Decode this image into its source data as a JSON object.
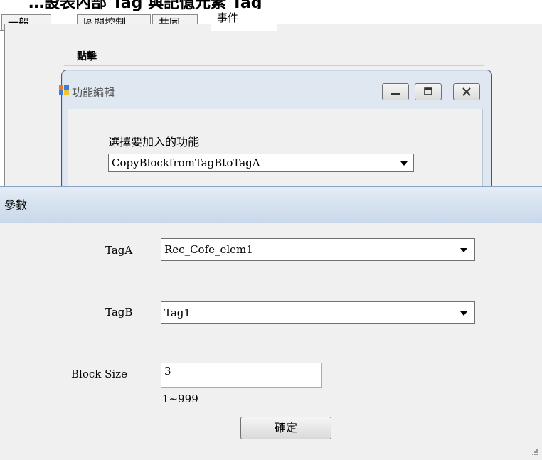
{
  "top_text": "…設表內部 Tag 與記憶元素 Tag",
  "tabs": [
    "一般",
    "區間控制",
    "共同",
    "事件"
  ],
  "active_tab": "事件",
  "section_label": "點擊",
  "function_dialog": {
    "title": "功能編輯",
    "icon": "app-window-icon",
    "choose_label": "選擇要加入的功能",
    "selected_function": "CopyBlockfromTagBtoTagA"
  },
  "params_dialog": {
    "title": "參數",
    "taga_label": "TagA",
    "taga_value": "Rec_Cofe_elem1",
    "tagb_label": "TagB",
    "tagb_value": "Tag1",
    "block_size_label": "Block Size",
    "block_size_value": "3",
    "range_hint": "1~999",
    "ok_label": "確定"
  },
  "colors": {
    "title_bar_top": "#e4ecf6",
    "title_bar_bottom": "#c9d8ea",
    "dialog_bg": "#f0f0f0"
  }
}
